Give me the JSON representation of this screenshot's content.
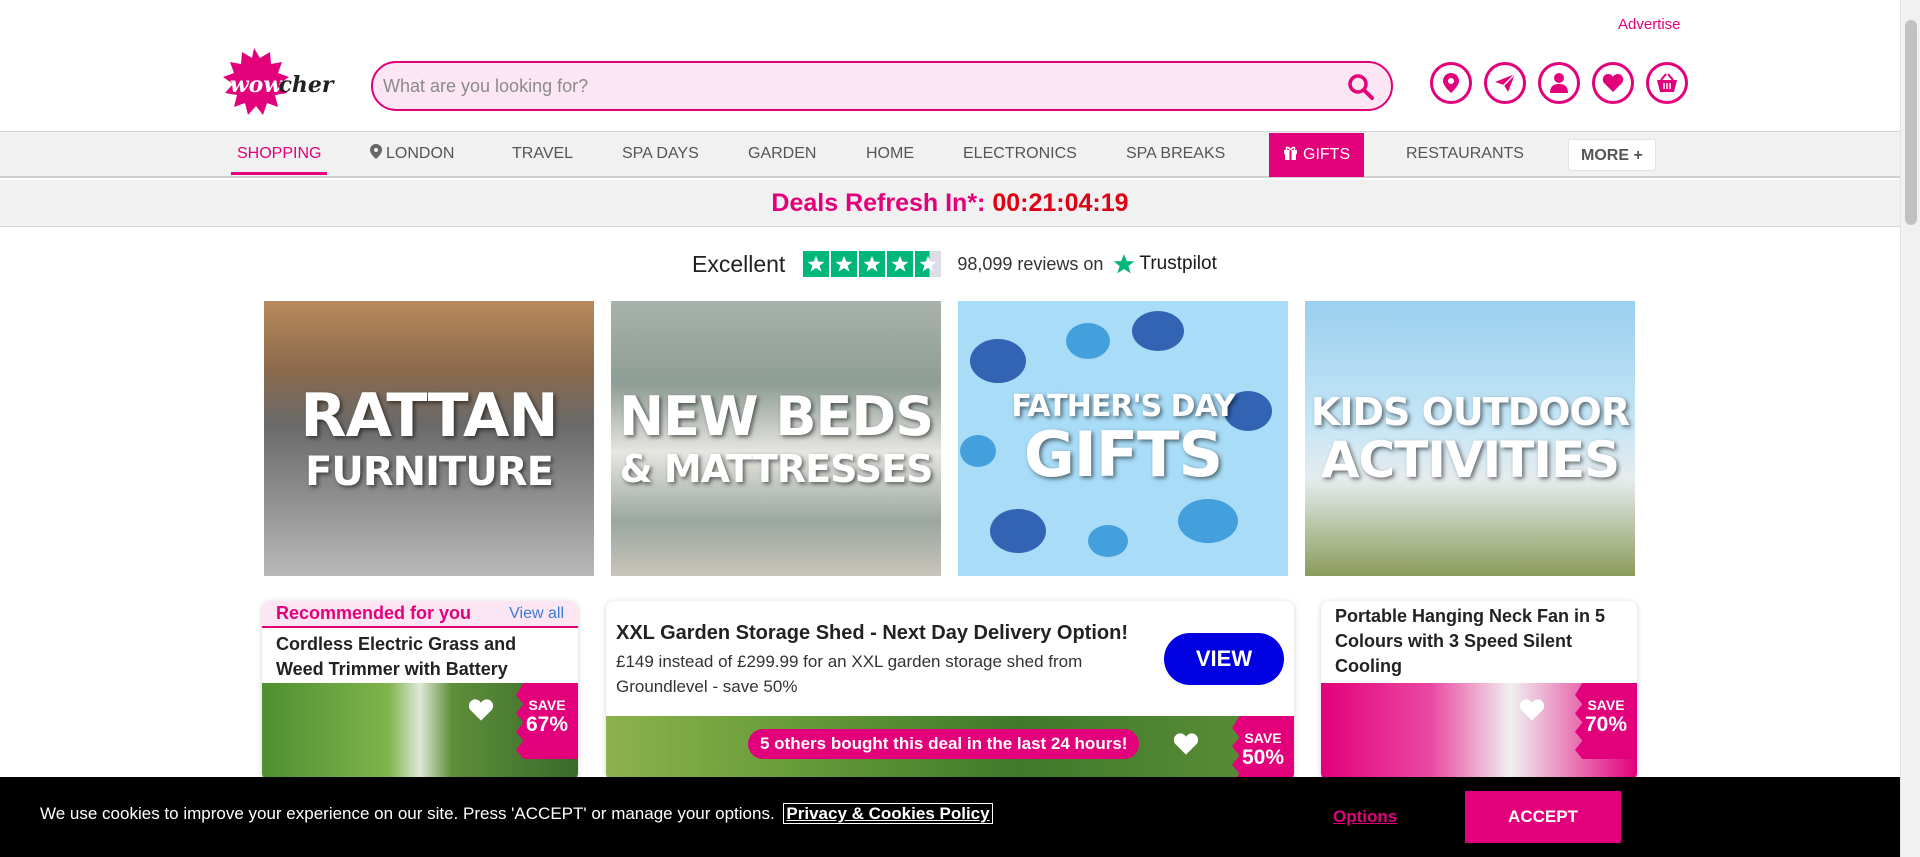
{
  "header": {
    "advertise_link": "Advertise",
    "logo_text": "wowcher",
    "search_placeholder": "What are you looking for?",
    "icons": [
      "location-pin-icon",
      "paper-plane-icon",
      "account-icon",
      "heart-icon",
      "basket-icon"
    ]
  },
  "nav": {
    "items": [
      {
        "label": "SHOPPING",
        "active": true
      },
      {
        "label": "LONDON",
        "icon": "location-pin-icon"
      },
      {
        "label": "TRAVEL"
      },
      {
        "label": "SPA DAYS"
      },
      {
        "label": "GARDEN"
      },
      {
        "label": "HOME"
      },
      {
        "label": "ELECTRONICS"
      },
      {
        "label": "SPA BREAKS"
      },
      {
        "label": "GIFTS",
        "icon": "gift-icon"
      },
      {
        "label": "RESTAURANTS"
      },
      {
        "label": "MORE +"
      }
    ]
  },
  "countdown": {
    "label": "Deals Refresh In*:",
    "timer": "00:21:04:19"
  },
  "trustpilot": {
    "rating_word": "Excellent",
    "stars": 4.5,
    "reviews_text": "98,099 reviews on",
    "brand": "Trustpilot"
  },
  "banners": [
    {
      "line1": "RATTAN",
      "line2": "FURNITURE"
    },
    {
      "line1": "NEW BEDS",
      "line2": "& MATTRESSES"
    },
    {
      "line1": "FATHER'S DAY",
      "line2": "GIFTS"
    },
    {
      "line1": "KIDS OUTDOOR",
      "line2": "ACTIVITIES"
    }
  ],
  "recommended": {
    "heading": "Recommended for you",
    "view_all": "View all",
    "deal_title": "Cordless Electric Grass and Weed Trimmer with Battery",
    "save_label": "SAVE",
    "save_pct": "67%"
  },
  "featured_deal": {
    "title": "XXL Garden Storage Shed - Next Day Delivery Option!",
    "description": "£149 instead of £299.99 for an XXL garden storage shed from Groundlevel - save 50%",
    "view_button": "VIEW",
    "bought_text": "5 others bought this deal in the last 24 hours!",
    "save_label": "SAVE",
    "save_pct": "50%"
  },
  "fan_deal": {
    "title": "Portable Hanging Neck Fan in 5 Colours with 3 Speed Silent Cooling",
    "save_label": "SAVE",
    "save_pct": "70%"
  },
  "cookie": {
    "message": "We use cookies to improve your experience on our site. Press 'ACCEPT' or manage your options.",
    "policy_link": "Privacy & Cookies Policy",
    "options_link": "Options",
    "accept_button": "ACCEPT"
  },
  "colors": {
    "brand_pink": "#e3007b",
    "view_blue": "#0000e0",
    "trustpilot_green": "#00b67a",
    "timer_red": "#e00016"
  }
}
